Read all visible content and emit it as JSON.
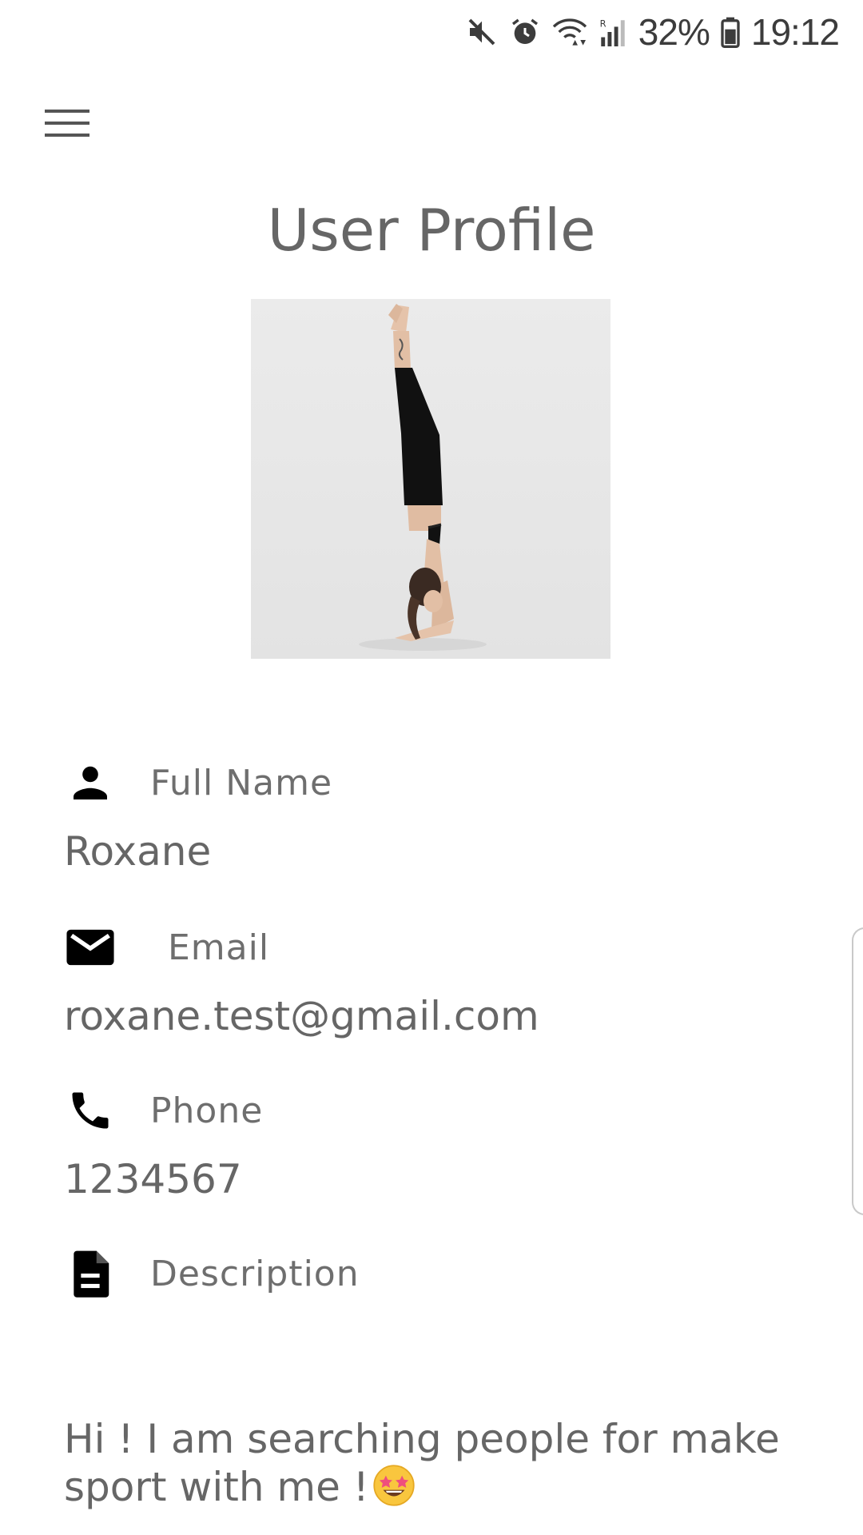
{
  "status_bar": {
    "battery_percent": "32%",
    "time": "19:12",
    "icons": [
      "mute-icon",
      "alarm-icon",
      "wifi-icon",
      "signal-icon",
      "battery-icon"
    ]
  },
  "header": {
    "menu_icon": "hamburger-menu-icon",
    "title": "User Profile"
  },
  "profile": {
    "avatar_icon": "profile-photo",
    "fields": {
      "name": {
        "icon": "person-icon",
        "label": "Full Name",
        "value": "Roxane"
      },
      "email": {
        "icon": "mail-icon",
        "label": "Email",
        "value": "roxane.test@gmail.com"
      },
      "phone": {
        "icon": "phone-icon",
        "label": "Phone",
        "value": "1234567"
      },
      "description": {
        "icon": "document-icon",
        "label": "Description",
        "value": "Hi ! I am searching people for make sport with me !",
        "emoji": "star-struck-emoji"
      }
    }
  },
  "colors": {
    "text": "#666666",
    "icon": "#000000",
    "background": "#ffffff",
    "avatar_bg": "#e6e6e6"
  }
}
